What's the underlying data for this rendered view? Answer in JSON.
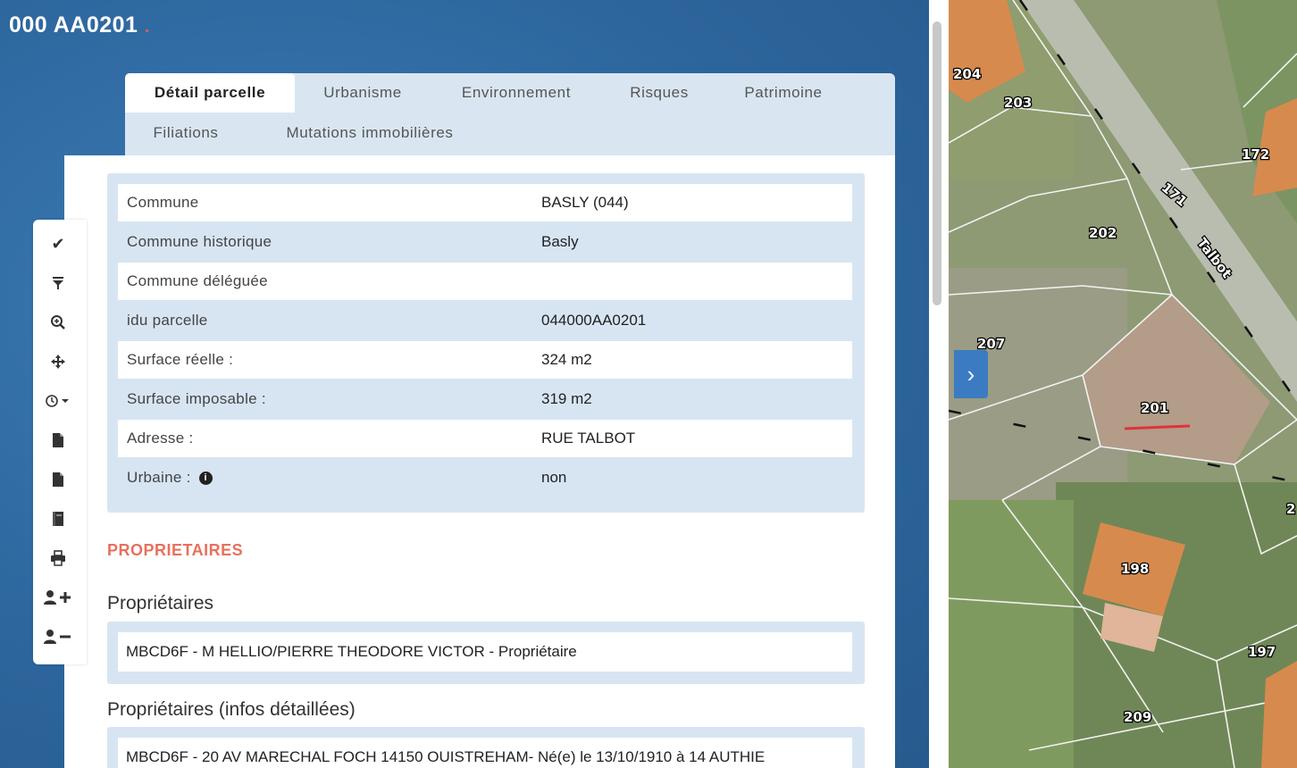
{
  "parcel": {
    "title": "000 AA0201",
    "title_dot": "."
  },
  "tabs": [
    {
      "label": "Détail parcelle",
      "active": true
    },
    {
      "label": "Urbanisme",
      "active": false
    },
    {
      "label": "Environnement",
      "active": false
    },
    {
      "label": "Risques",
      "active": false
    },
    {
      "label": "Patrimoine",
      "active": false
    },
    {
      "label": "Filiations",
      "active": false
    },
    {
      "label": "Mutations immobilières",
      "active": false
    }
  ],
  "details": [
    {
      "label": "Commune",
      "value": "BASLY (044)"
    },
    {
      "label": "Commune historique",
      "value": "Basly"
    },
    {
      "label": "Commune déléguée",
      "value": ""
    },
    {
      "label": "idu parcelle",
      "value": "044000AA0201"
    },
    {
      "label": "Surface réelle :",
      "value": "324 m2"
    },
    {
      "label": "Surface imposable :",
      "value": "319 m2"
    },
    {
      "label": "Adresse :",
      "value": "RUE TALBOT"
    },
    {
      "label": "Urbaine :",
      "value": "non"
    }
  ],
  "owners": {
    "section_heading": "PROPRIETAIRES",
    "owners_heading": "Propriétaires",
    "owner_line": "MBCD6F - M HELLIO/PIERRE THEODORE VICTOR - Propriétaire",
    "detailed_heading": "Propriétaires (infos détaillées)",
    "detailed_line": "MBCD6F - 20 AV MARECHAL FOCH 14150 OUISTREHAM- Né(e) le 13/10/1910 à 14 AUTHIE"
  },
  "toolbar_icons": [
    "check-icon",
    "filter-icon",
    "zoom-in-icon",
    "move-icon",
    "clock-dropdown-icon",
    "file-icon",
    "file-alt-icon",
    "book-icon",
    "print-icon",
    "user-add-icon",
    "user-remove-icon"
  ],
  "map": {
    "street_label": "Talbot",
    "parcel_labels": [
      "204",
      "203",
      "172",
      "171",
      "202",
      "207",
      "201",
      "198",
      "197",
      "209",
      "2"
    ],
    "colors": {
      "building": "#d78a4e",
      "selected_parcel": "#e0323c",
      "map_ground": "#8d9a74"
    }
  }
}
